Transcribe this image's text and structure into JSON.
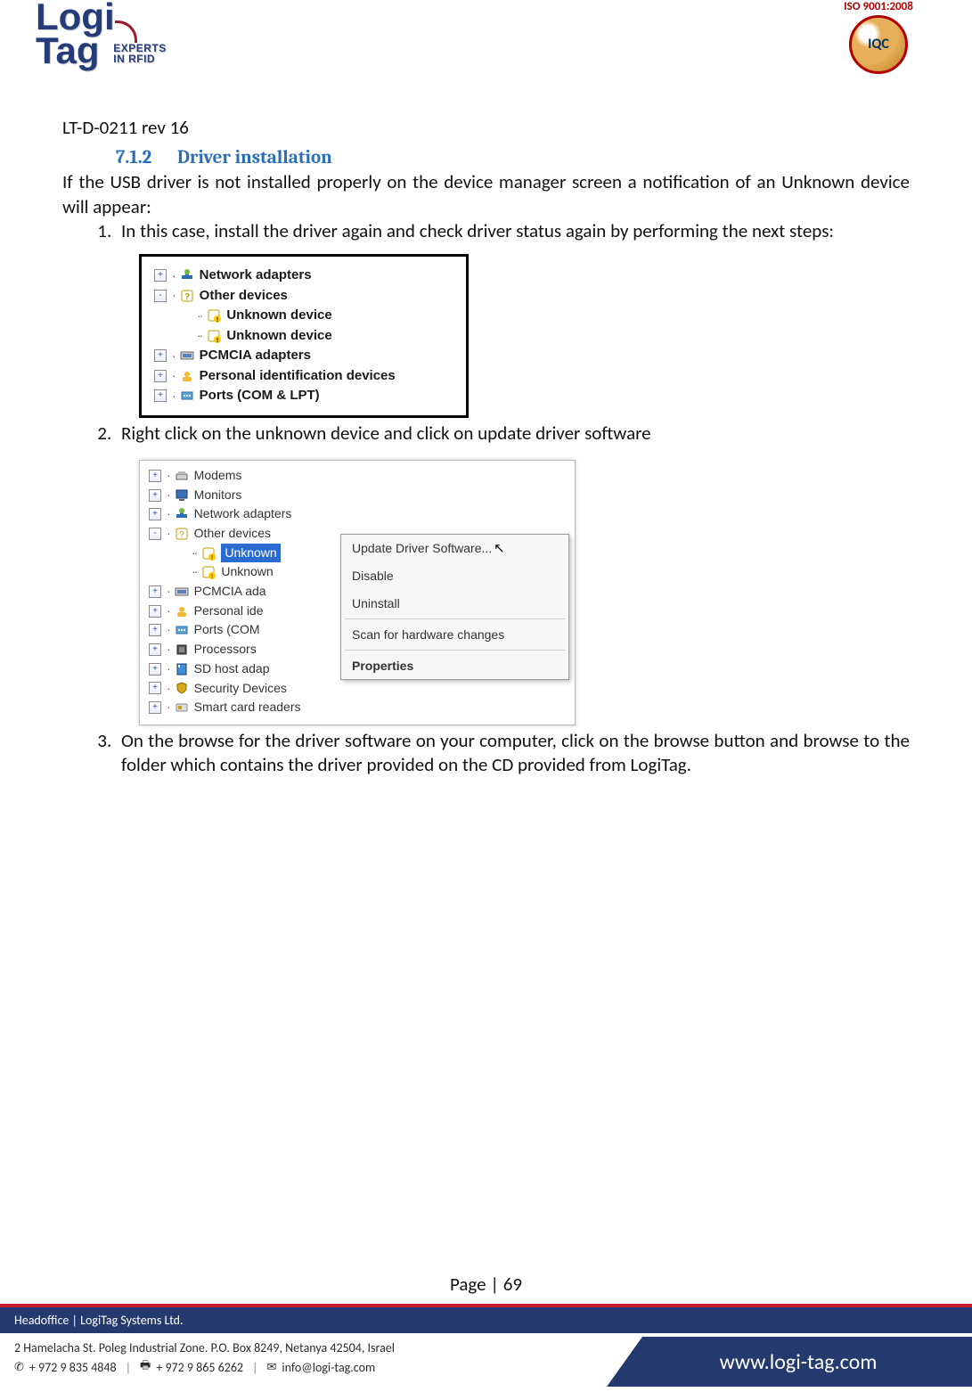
{
  "doc": {
    "id": "LT-D-0211 rev 16",
    "logo": {
      "top": "Logi",
      "bottom": "Tag",
      "tagline1": "EXPERTS",
      "tagline2": "IN RFID"
    },
    "iso": {
      "arch": "ISO 9001:2008",
      "center": "IQC"
    },
    "section": {
      "num": "7.1.2",
      "title": "Driver installation"
    },
    "intro": "If the USB driver is not installed properly on the device manager screen a notification of an Unknown device will appear:",
    "steps": [
      "In this case, install the driver again and check driver status again by performing the next steps:",
      "Right click on the unknown device and click on update driver software",
      "On the browse for the driver software on your computer, click on the browse button and browse to the folder which contains the driver provided on the CD provided from LogiTag."
    ],
    "page_label": "Page | 69"
  },
  "shot1": {
    "items": [
      {
        "exp": "+",
        "depth": 1,
        "icon": "net",
        "label": "Network adapters"
      },
      {
        "exp": "-",
        "depth": 1,
        "icon": "other",
        "label": "Other devices"
      },
      {
        "exp": "",
        "depth": 2,
        "icon": "unknown",
        "label": "Unknown device"
      },
      {
        "exp": "",
        "depth": 2,
        "icon": "unknown",
        "label": "Unknown device"
      },
      {
        "exp": "+",
        "depth": 1,
        "icon": "pcmcia",
        "label": "PCMCIA adapters"
      },
      {
        "exp": "+",
        "depth": 1,
        "icon": "pid",
        "label": "Personal identification devices"
      },
      {
        "exp": "+",
        "depth": 1,
        "icon": "ports",
        "label": "Ports (COM & LPT)"
      }
    ]
  },
  "shot2": {
    "items": [
      {
        "exp": "+",
        "depth": 1,
        "icon": "modem",
        "label": "Modems"
      },
      {
        "exp": "+",
        "depth": 1,
        "icon": "monitor",
        "label": "Monitors"
      },
      {
        "exp": "+",
        "depth": 1,
        "icon": "net",
        "label": "Network adapters"
      },
      {
        "exp": "-",
        "depth": 1,
        "icon": "other",
        "label": "Other devices"
      },
      {
        "exp": "",
        "depth": 2,
        "icon": "unknown",
        "label": "Unknown",
        "selected": true,
        "cut": true
      },
      {
        "exp": "",
        "depth": 2,
        "icon": "unknown",
        "label": "Unknown",
        "cut": true
      },
      {
        "exp": "+",
        "depth": 1,
        "icon": "pcmcia",
        "label": "PCMCIA ada",
        "cut": true
      },
      {
        "exp": "+",
        "depth": 1,
        "icon": "pid",
        "label": "Personal ide",
        "cut": true
      },
      {
        "exp": "+",
        "depth": 1,
        "icon": "ports",
        "label": "Ports (COM",
        "cut": true
      },
      {
        "exp": "+",
        "depth": 1,
        "icon": "cpu",
        "label": "Processors"
      },
      {
        "exp": "+",
        "depth": 1,
        "icon": "sd",
        "label": "SD host adap",
        "cut": true
      },
      {
        "exp": "+",
        "depth": 1,
        "icon": "sec",
        "label": "Security Devices",
        "faded": true
      },
      {
        "exp": "+",
        "depth": 1,
        "icon": "smart",
        "label": "Smart card readers"
      }
    ],
    "menu": [
      {
        "label": "Update Driver Software...",
        "cursor": true
      },
      {
        "label": "Disable"
      },
      {
        "label": "Uninstall"
      },
      {
        "sep": true
      },
      {
        "label": "Scan for hardware changes"
      },
      {
        "sep": true
      },
      {
        "label": "Properties",
        "bold": true
      }
    ]
  },
  "footer": {
    "head": "Headoffice   |   LogiTag Systems Ltd.",
    "addr": "2 Hamelacha St. Poleg Industrial Zone.  P.O. Box 8249, Netanya 42504, Israel",
    "phone": "+ 972 9 835 4848",
    "fax": "+ 972 9 865 6262",
    "email": "info@logi-tag.com",
    "url": "www.logi-tag.com"
  }
}
